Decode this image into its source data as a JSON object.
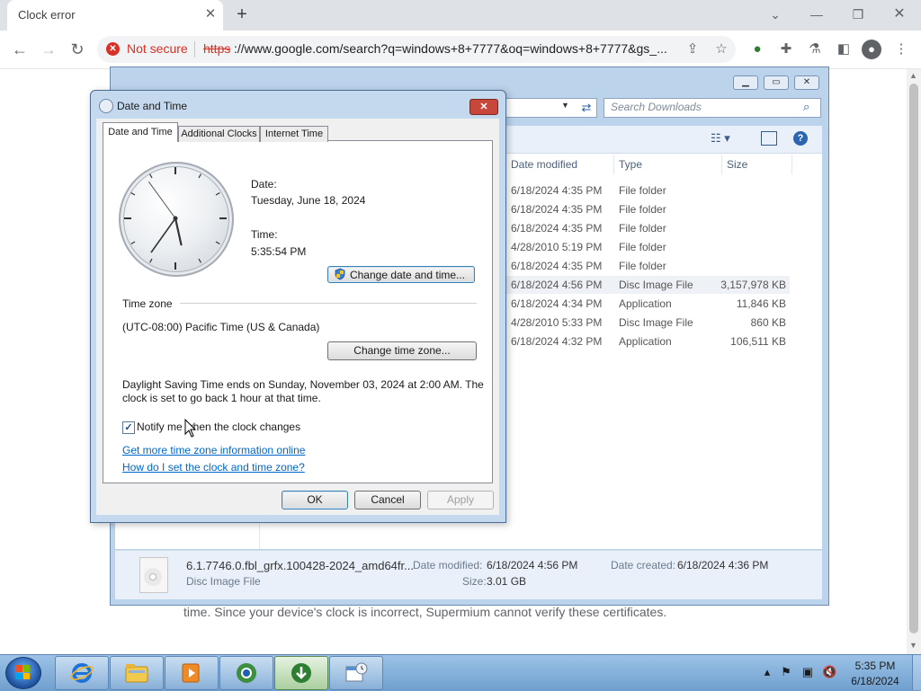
{
  "browser": {
    "tab_title": "Clock error",
    "security_label": "Not secure",
    "url_scheme": "https",
    "url_rest": "://www.google.com/search?q=windows+8+7777&oq=windows+8+7777&gs_...",
    "page_text": "time. Since your device's clock is incorrect, Supermium cannot verify these certificates."
  },
  "explorer": {
    "search_placeholder": "Search Downloads",
    "columns": [
      "Date modified",
      "Type",
      "Size"
    ],
    "rows": [
      {
        "date": "6/18/2024 4:35 PM",
        "type": "File folder",
        "size": ""
      },
      {
        "date": "6/18/2024 4:35 PM",
        "type": "File folder",
        "size": ""
      },
      {
        "date": "6/18/2024 4:35 PM",
        "type": "File folder",
        "size": ""
      },
      {
        "date": "4/28/2010 5:19 PM",
        "type": "File folder",
        "size": ""
      },
      {
        "date": "6/18/2024 4:35 PM",
        "type": "File folder",
        "size": ""
      },
      {
        "date": "6/18/2024 4:56 PM",
        "type": "Disc Image File",
        "size": "3,157,978 KB"
      },
      {
        "date": "6/18/2024 4:34 PM",
        "type": "Application",
        "size": "11,846 KB"
      },
      {
        "date": "4/28/2010 5:33 PM",
        "type": "Disc Image File",
        "size": "860 KB"
      },
      {
        "date": "6/18/2024 4:32 PM",
        "type": "Application",
        "size": "106,511 KB"
      }
    ],
    "details": {
      "filename": "6.1.7746.0.fbl_grfx.100428-2024_amd64fr...",
      "filetype": "Disc Image File",
      "date_modified_label": "Date modified:",
      "date_modified": "6/18/2024 4:56 PM",
      "date_created_label": "Date created:",
      "date_created": "6/18/2024 4:36 PM",
      "size_label": "Size:",
      "size": "3.01 GB"
    }
  },
  "dialog": {
    "title": "Date and Time",
    "tabs": [
      "Date and Time",
      "Additional Clocks",
      "Internet Time"
    ],
    "date_label": "Date:",
    "date_value": "Tuesday, June 18, 2024",
    "time_label": "Time:",
    "time_value": "5:35:54 PM",
    "change_datetime": "Change date and time...",
    "timezone_label": "Time zone",
    "timezone_value": "(UTC-08:00) Pacific Time (US & Canada)",
    "change_timezone": "Change time zone...",
    "dst_line1": "Daylight Saving Time ends on Sunday, November 03, 2024 at 2:00 AM. The",
    "dst_line2": "clock is set to go back 1 hour at that time.",
    "notify_label": "Notify me when the clock changes",
    "notify_checked": true,
    "link_more_info": "Get more time zone information online",
    "link_how_set": "How do I set the clock and time zone?",
    "ok": "OK",
    "cancel": "Cancel",
    "apply": "Apply",
    "clock": {
      "hour": 5,
      "minute": 35,
      "second": 54
    }
  },
  "taskbar": {
    "tasks": [
      "internet-explorer",
      "file-explorer",
      "media-player",
      "supermium-browser",
      "download-manager",
      "control-panel"
    ],
    "tray_time": "5:35 PM",
    "tray_date": "6/18/2024"
  },
  "colors": {
    "insecure_red": "#d93025",
    "link_blue": "#0066cc",
    "taskbar_blue": "#6f9fcf"
  }
}
